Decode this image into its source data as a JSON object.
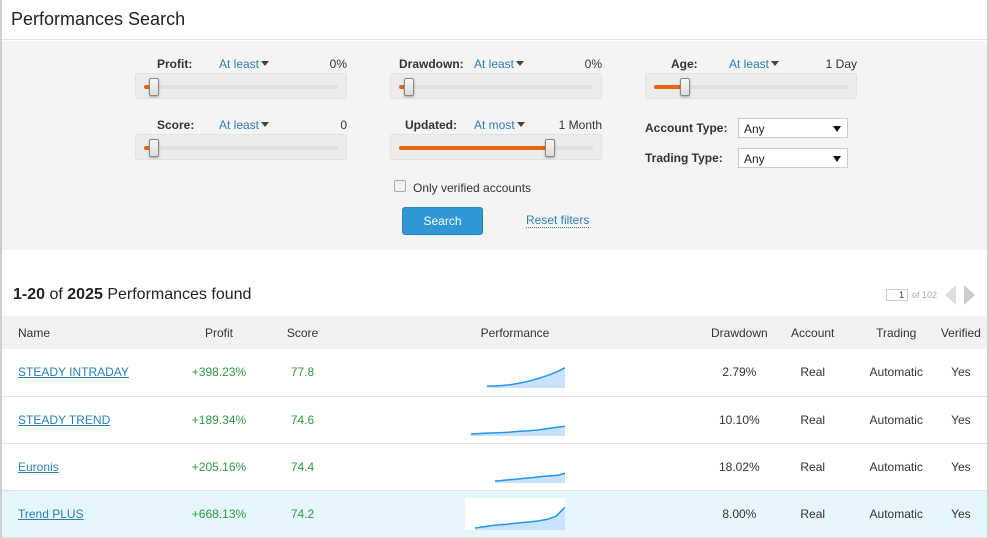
{
  "page": {
    "title": "Performances Search"
  },
  "filters": {
    "profit": {
      "label": "Profit:",
      "mode": "At least",
      "value": "0%",
      "level": 0.05
    },
    "drawdown": {
      "label": "Drawdown:",
      "mode": "At least",
      "value": "0%",
      "level": 0.05
    },
    "age": {
      "label": "Age:",
      "mode": "At least",
      "value": "1 Day",
      "level": 0.16
    },
    "score": {
      "label": "Score:",
      "mode": "At least",
      "value": "0",
      "level": 0.05
    },
    "updated": {
      "label": "Updated:",
      "mode": "At most",
      "value": "1 Month",
      "level": 0.78
    },
    "account_type": {
      "label": "Account Type:",
      "value": "Any"
    },
    "trading_type": {
      "label": "Trading Type:",
      "value": "Any"
    },
    "verified_only": {
      "label": "Only verified accounts",
      "checked": false
    },
    "search_label": "Search",
    "reset_label": "Reset filters"
  },
  "results": {
    "range": "1-20",
    "of_word": "of",
    "total": "2025",
    "suffix": "Performances found",
    "pager": {
      "page": "1",
      "of_label": "of 102"
    }
  },
  "table": {
    "columns": [
      "Name",
      "Profit",
      "Score",
      "Performance",
      "Drawdown",
      "Account",
      "Trading",
      "Verified"
    ],
    "rows": [
      {
        "name": "STEADY INTRADAY",
        "profit": "+398.23%",
        "score": "77.8",
        "drawdown": "2.79%",
        "account": "Real",
        "trading": "Automatic",
        "verified": "Yes",
        "spark": [
          0,
          0,
          0.02,
          0.05,
          0.1,
          0.16,
          0.24,
          0.33,
          0.43,
          0.55,
          0.7
        ],
        "spark_start": 0.22
      },
      {
        "name": "STEADY TREND",
        "profit": "+189.34%",
        "score": "74.6",
        "drawdown": "10.10%",
        "account": "Real",
        "trading": "Automatic",
        "verified": "Yes",
        "spark": [
          0,
          0.02,
          0.04,
          0.05,
          0.07,
          0.1,
          0.12,
          0.15,
          0.2,
          0.25,
          0.3
        ],
        "spark_start": 0.06
      },
      {
        "name": "Euronis",
        "profit": "+205.16%",
        "score": "74.4",
        "drawdown": "18.02%",
        "account": "Real",
        "trading": "Automatic",
        "verified": "Yes",
        "spark": [
          0,
          0.02,
          0.05,
          0.07,
          0.1,
          0.12,
          0.15,
          0.18,
          0.2,
          0.22,
          0.3
        ],
        "spark_start": 0.3
      },
      {
        "name": "Trend PLUS",
        "profit": "+668.13%",
        "score": "74.2",
        "drawdown": "8.00%",
        "account": "Real",
        "trading": "Automatic",
        "verified": "Yes",
        "spark": [
          0,
          0.05,
          0.1,
          0.13,
          0.16,
          0.2,
          0.23,
          0.27,
          0.33,
          0.45,
          0.8
        ],
        "spark_start": 0.1
      }
    ]
  },
  "colors": {
    "accent": "#2f97d6",
    "slider_fill": "#e8650c",
    "positive": "#2d9a3e",
    "link": "#2a7fb8",
    "highlight_row": "#e6f6fd",
    "spark_line": "#2196f3",
    "spark_fill": "#c8e2ff"
  }
}
